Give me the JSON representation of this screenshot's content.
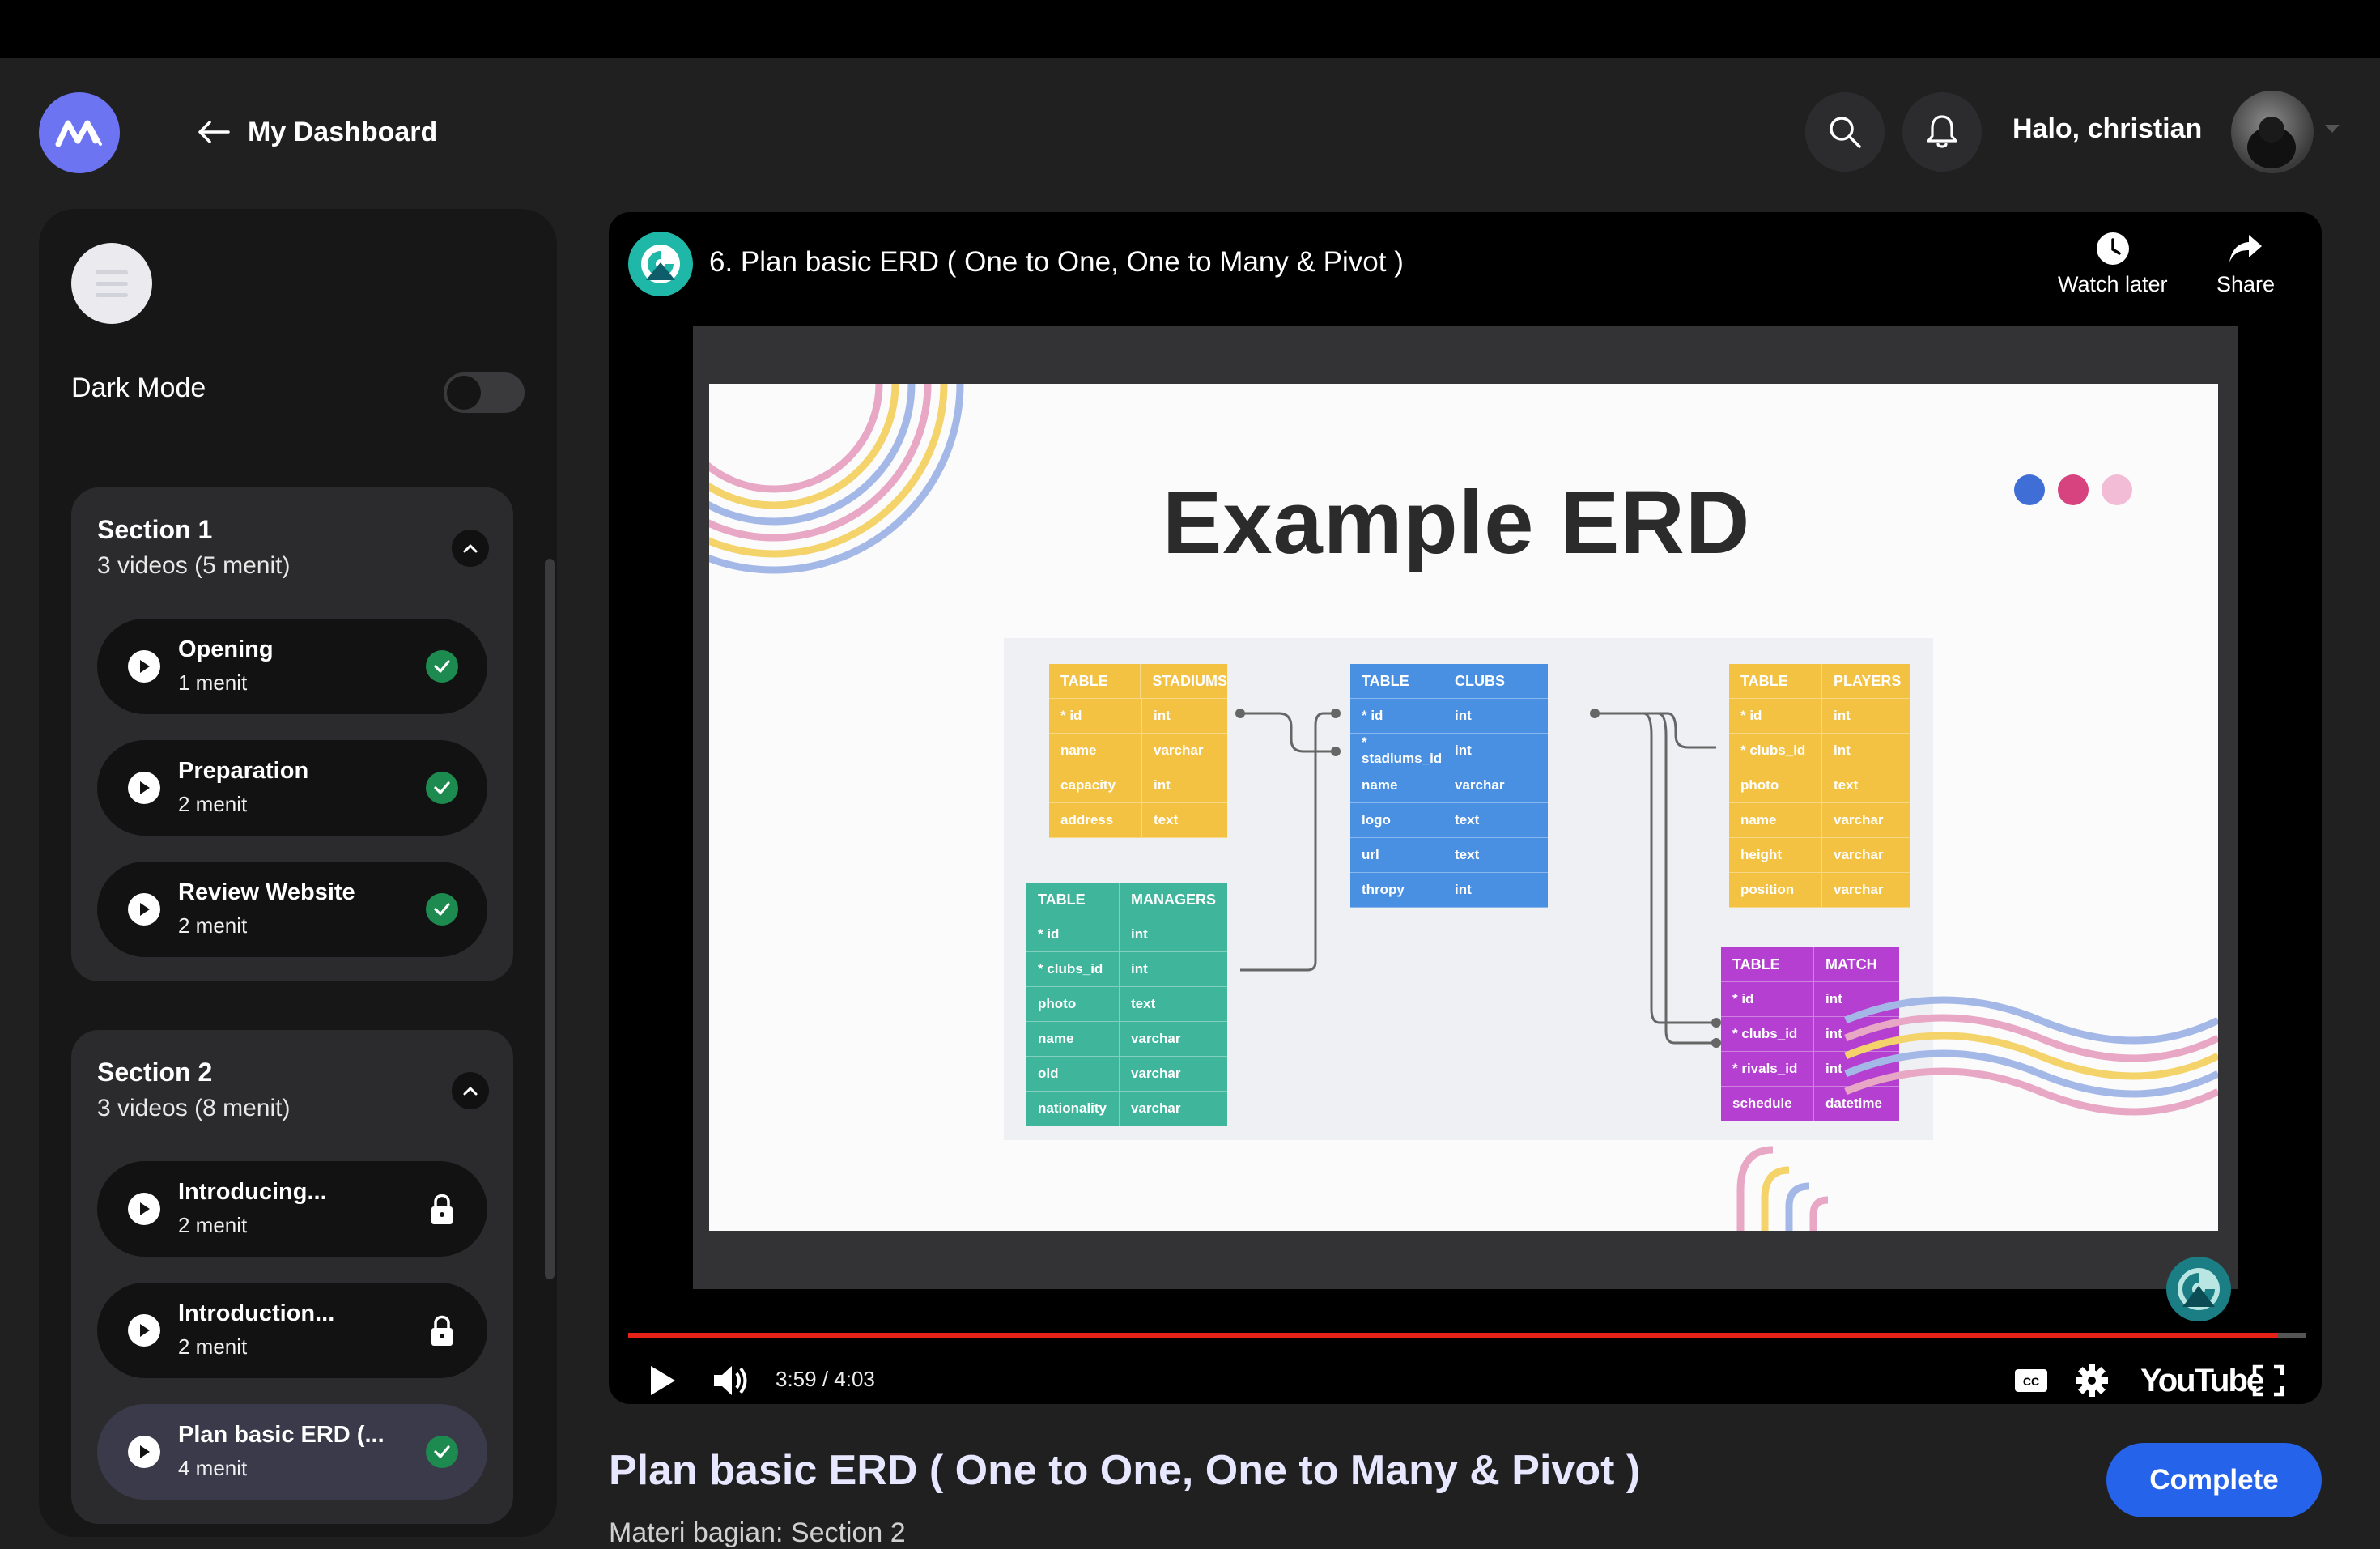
{
  "header": {
    "back_title": "My Dashboard",
    "greeting": "Halo, christian"
  },
  "sidebar": {
    "dark_mode_label": "Dark Mode",
    "dark_mode_on": false,
    "sections": [
      {
        "title": "Section 1",
        "subtitle": "3 videos (5 menit)",
        "items": [
          {
            "title": "Opening",
            "duration": "1 menit",
            "status": "completed"
          },
          {
            "title": "Preparation",
            "duration": "2 menit",
            "status": "completed"
          },
          {
            "title": "Review Website",
            "duration": "2 menit",
            "status": "completed"
          }
        ]
      },
      {
        "title": "Section 2",
        "subtitle": "3 videos (8 menit)",
        "items": [
          {
            "title": "Introducing...",
            "duration": "2 menit",
            "status": "locked"
          },
          {
            "title": "Introduction...",
            "duration": "2 menit",
            "status": "locked"
          },
          {
            "title": "Plan basic ERD (...",
            "duration": "4 menit",
            "status": "completed-active"
          }
        ]
      }
    ]
  },
  "player": {
    "video_title": "6. Plan basic ERD ( One to One, One to Many & Pivot )",
    "watch_later_label": "Watch later",
    "share_label": "Share",
    "time_display": "3:59 / 4:03",
    "progress_fraction": 0.983,
    "youtube_label": "YouTube",
    "slide": {
      "title": "Example ERD",
      "tables": {
        "stadiums": {
          "header": [
            "TABLE",
            "STADIUMS"
          ],
          "rows": [
            [
              "* id",
              "int"
            ],
            [
              "name",
              "varchar"
            ],
            [
              "capacity",
              "int"
            ],
            [
              "address",
              "text"
            ]
          ],
          "color": "#f4c242"
        },
        "clubs": {
          "header": [
            "TABLE",
            "CLUBS"
          ],
          "rows": [
            [
              "* id",
              "int"
            ],
            [
              "* stadiums_id",
              "int"
            ],
            [
              "name",
              "varchar"
            ],
            [
              "logo",
              "text"
            ],
            [
              "url",
              "text"
            ],
            [
              "thropy",
              "int"
            ]
          ],
          "color": "#4a90e2"
        },
        "players": {
          "header": [
            "TABLE",
            "PLAYERS"
          ],
          "rows": [
            [
              "* id",
              "int"
            ],
            [
              "* clubs_id",
              "int"
            ],
            [
              "photo",
              "text"
            ],
            [
              "name",
              "varchar"
            ],
            [
              "height",
              "varchar"
            ],
            [
              "position",
              "varchar"
            ]
          ],
          "color": "#f4c242"
        },
        "managers": {
          "header": [
            "TABLE",
            "MANAGERS"
          ],
          "rows": [
            [
              "* id",
              "int"
            ],
            [
              "* clubs_id",
              "int"
            ],
            [
              "photo",
              "text"
            ],
            [
              "name",
              "varchar"
            ],
            [
              "old",
              "varchar"
            ],
            [
              "nationality",
              "varchar"
            ]
          ],
          "color": "#3fb59c"
        },
        "match": {
          "header": [
            "TABLE",
            "MATCH"
          ],
          "rows": [
            [
              "* id",
              "int"
            ],
            [
              "* clubs_id",
              "int"
            ],
            [
              "* rivals_id",
              "int"
            ],
            [
              "schedule",
              "datetime"
            ]
          ],
          "color": "#b43fd0"
        }
      }
    }
  },
  "lesson": {
    "title": "Plan basic ERD ( One to One, One to Many & Pivot )",
    "subtitle": "Materi bagian: Section 2",
    "complete_label": "Complete"
  },
  "colors": {
    "accent": "#2563eb",
    "check_green": "#1d8a4f",
    "logo_purple": "#6c74f2",
    "progress_red": "#e62117"
  }
}
